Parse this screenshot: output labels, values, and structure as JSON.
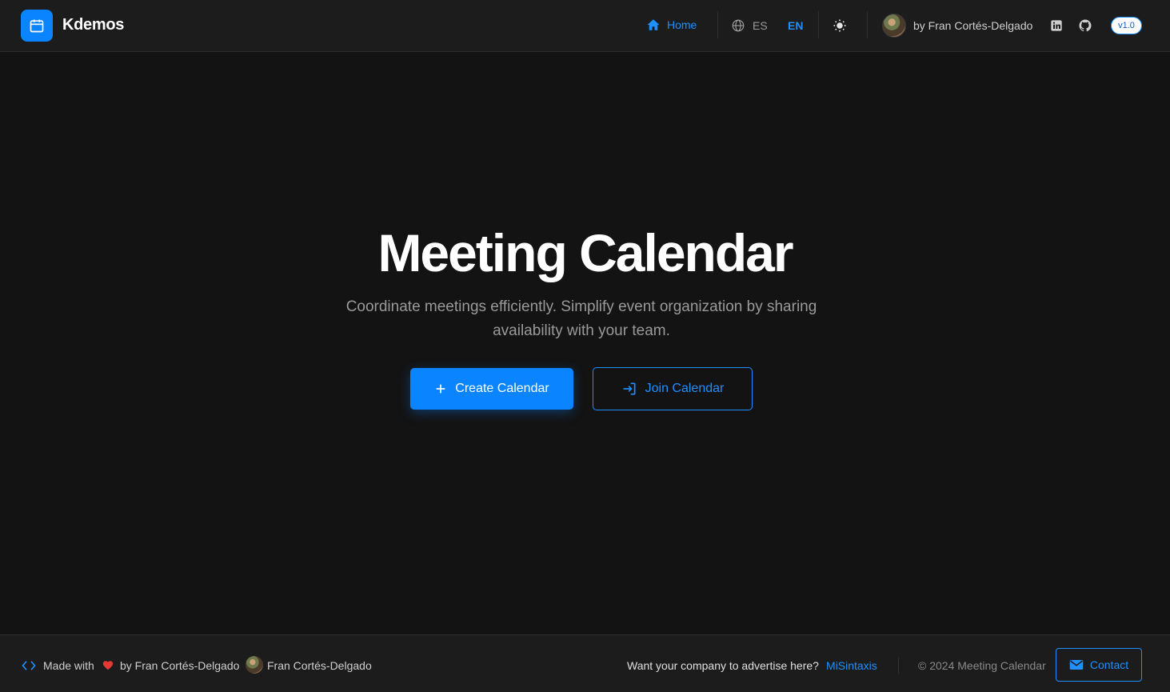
{
  "header": {
    "brand": "Kdemos",
    "nav_home": "Home",
    "lang_es": "ES",
    "lang_en": "EN",
    "author": "by Fran Cortés-Delgado",
    "version": "v1.0"
  },
  "hero": {
    "title": "Meeting Calendar",
    "subtitle": "Coordinate meetings efficiently. Simplify event organization by sharing availability with your team.",
    "create_label": "Create Calendar",
    "join_label": "Join Calendar"
  },
  "footer": {
    "made_with": "Made with",
    "by_author": "by Fran Cortés-Delgado",
    "author_name": "Fran Cortés-Delgado",
    "advertise": "Want your company to advertise here?",
    "advertise_link": "MiSintaxis",
    "copyright": "© 2024 Meeting Calendar",
    "contact_label": "Contact"
  },
  "colors": {
    "accent": "#0a84ff",
    "background": "#131313",
    "header_bg": "#1c1c1c"
  },
  "icons": [
    "calendar-icon",
    "home-icon",
    "globe-icon",
    "sun-icon",
    "linkedin-icon",
    "github-icon",
    "plus-icon",
    "login-icon",
    "code-icon",
    "heart-icon",
    "mail-icon"
  ]
}
